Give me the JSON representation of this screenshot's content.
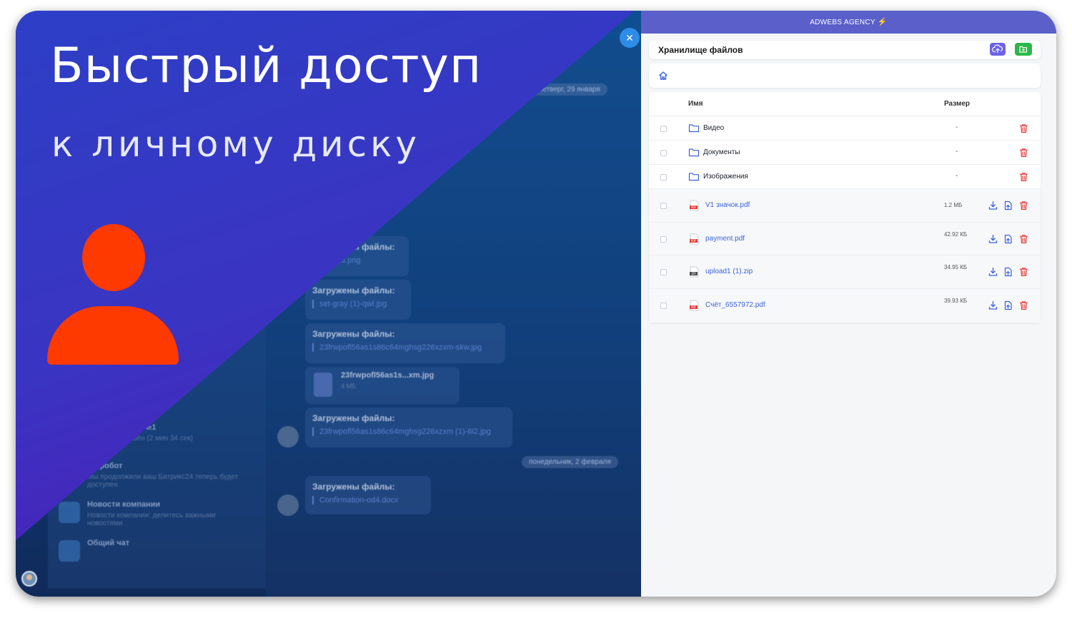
{
  "brand": {
    "name": "ADWEBS AGENCY",
    "bolt": "⚡"
  },
  "headline": "Быстрый доступ",
  "subheadline": "к личному диску",
  "storage": {
    "title": "Хранилище файлов",
    "columns": {
      "name": "Имя",
      "size": "Размер"
    },
    "folders": [
      {
        "name": "Видео",
        "size": "-"
      },
      {
        "name": "Документы",
        "size": "-"
      },
      {
        "name": "Изображения",
        "size": "-"
      }
    ],
    "files": [
      {
        "name": "V1 значок.pdf",
        "size": "1.2 МБ",
        "type": "PDF"
      },
      {
        "name": "payment.pdf",
        "size": "42.92 КБ",
        "type": "PDF"
      },
      {
        "name": "upload1 (1).zip",
        "size": "34.95 КБ",
        "type": "ZIP"
      },
      {
        "name": "Счёт_6557972.pdf",
        "size": "39.93 КБ",
        "type": "PDF"
      }
    ]
  },
  "background_chat": {
    "date1": "четверг, 29 января",
    "date2": "понедельник, 2 февраля",
    "uploaded_label": "Загружены файлы:",
    "files": [
      "ulti-e68.png",
      "set-gray (1)-qwl.jpg",
      "23frwpofl56as1s86c64mghsg226xzxm-skw.jpg",
      "23frwpofl56as1s86c64mghsg226xzxm (1)-6l2.jpg",
      "Confirmation-od4.docx"
    ],
    "attachment": {
      "name": "23frwpofl56as1s...xm.jpg",
      "size": "4 МБ"
    },
    "chats": [
      {
        "name": "Конференция №1",
        "text": "Звонок завершён (2 мин 34 сек)"
      },
      {
        "name": "Инфобот",
        "text": "Мы продолжили ваш Битрикс24 теперь будет доступен"
      },
      {
        "name": "Новости компании",
        "text": "Новости компании: делитесь важными новостями"
      },
      {
        "name": "Общий чат",
        "text": ""
      }
    ]
  },
  "colors": {
    "accent_purple": "#5a5fc9",
    "upload_button": "#6c63e8",
    "folder_button": "#2bb84a",
    "delete": "#e53935",
    "action_blue": "#3a63d6",
    "person_icon": "#ff3a00"
  }
}
